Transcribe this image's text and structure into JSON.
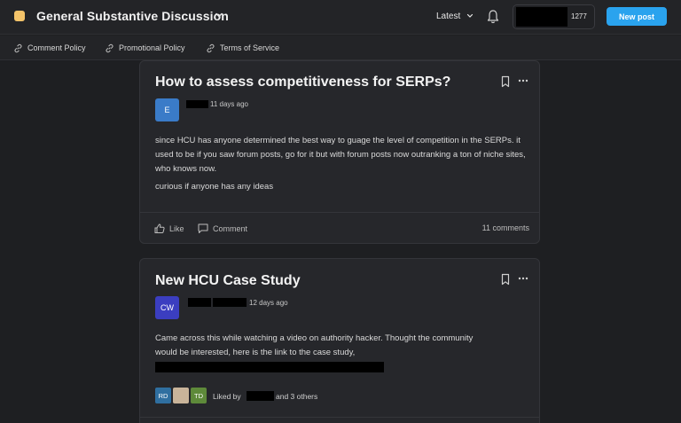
{
  "header": {
    "community_title": "General Substantive Discussion",
    "sort_label": "Latest",
    "user_points": "1277",
    "new_post_label": "New post"
  },
  "policy_links": [
    {
      "label": "Comment Policy",
      "icon": "link-icon"
    },
    {
      "label": "Promotional Policy",
      "icon": "link-icon"
    },
    {
      "label": "Terms of Service",
      "icon": "link-icon"
    }
  ],
  "posts": [
    {
      "title": "How to assess competitiveness for SERPs?",
      "avatar_initials": "E",
      "avatar_color": "#3a7bc8",
      "time": "11 days ago",
      "body": [
        "since HCU has anyone determined the best way to guage the level of competition in the SERPs. it used to be if you saw forum posts, go for it but with forum posts now outranking a ton of niche sites, who knows now.",
        "curious if anyone has any ideas"
      ],
      "like_label": "Like",
      "comment_label": "Comment",
      "comments_count": "11 comments"
    },
    {
      "title": "New HCU Case Study",
      "avatar_initials": "CW",
      "avatar_color": "#3b3ec0",
      "time": "12 days ago",
      "body": [
        "Came across this while watching a video on authority hacker.  Thought the community would be interested, here is the link to the case study,"
      ],
      "likers": [
        {
          "initials": "RD",
          "color": "#2f6fa0"
        },
        {
          "initials": "",
          "color": "#c9b49a"
        },
        {
          "initials": "TD",
          "color": "#5e8a3a"
        }
      ],
      "liked_by_prefix": "Liked by",
      "liked_by_suffix": "and 3 others"
    }
  ],
  "colors": {
    "background": "#1e1f22",
    "card": "#26272b",
    "accent": "#2aa3ee",
    "community_icon": "#f4c46a"
  }
}
